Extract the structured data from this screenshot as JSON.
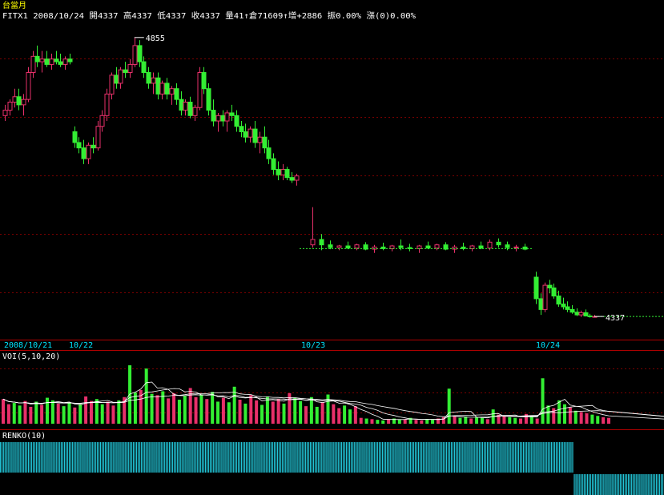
{
  "header": {
    "instrument": "台當月",
    "quote_line": "FITX1 2008/10/24 開4337 高4337 低4337 收4337 量41↑倉71609↑增+2886 振0.00% 漲(0)0.00%"
  },
  "colors": {
    "up": "#e8306a",
    "down": "#33ee33",
    "text_yellow": "#ffff00",
    "text_white": "#ffffff",
    "axis_date": "#00e5ff",
    "grid": "#7a0000",
    "renko": "#22c6d8",
    "ma_line": "#ffffff"
  },
  "chart_data": [
    {
      "type": "candlestick",
      "title": "台當月",
      "symbol": "FITX1",
      "x_labels": [
        "2008/10/21",
        "10/22",
        "10/23",
        "10/24"
      ],
      "annotations": [
        {
          "label": "4855",
          "value": 4855
        },
        {
          "label": "4337",
          "value": 4337
        }
      ],
      "ohlc": [
        [
          4710,
          4730,
          4700,
          4720
        ],
        [
          4720,
          4740,
          4710,
          4735
        ],
        [
          4735,
          4760,
          4725,
          4745
        ],
        [
          4745,
          4760,
          4720,
          4730
        ],
        [
          4730,
          4750,
          4710,
          4740
        ],
        [
          4740,
          4800,
          4735,
          4790
        ],
        [
          4790,
          4830,
          4780,
          4820
        ],
        [
          4820,
          4840,
          4800,
          4810
        ],
        [
          4810,
          4830,
          4790,
          4815
        ],
        [
          4815,
          4830,
          4800,
          4805
        ],
        [
          4805,
          4825,
          4795,
          4815
        ],
        [
          4815,
          4830,
          4805,
          4810
        ],
        [
          4810,
          4825,
          4800,
          4805
        ],
        [
          4805,
          4820,
          4795,
          4815
        ],
        [
          4815,
          4825,
          4805,
          4810
        ],
        [
          4680,
          4690,
          4650,
          4660
        ],
        [
          4660,
          4670,
          4640,
          4650
        ],
        [
          4650,
          4665,
          4620,
          4630
        ],
        [
          4630,
          4660,
          4620,
          4655
        ],
        [
          4655,
          4670,
          4640,
          4650
        ],
        [
          4650,
          4700,
          4645,
          4690
        ],
        [
          4690,
          4720,
          4680,
          4710
        ],
        [
          4710,
          4760,
          4700,
          4750
        ],
        [
          4750,
          4790,
          4740,
          4785
        ],
        [
          4785,
          4800,
          4760,
          4770
        ],
        [
          4770,
          4800,
          4760,
          4795
        ],
        [
          4795,
          4810,
          4780,
          4790
        ],
        [
          4790,
          4815,
          4780,
          4805
        ],
        [
          4805,
          4855,
          4800,
          4840
        ],
        [
          4840,
          4850,
          4800,
          4810
        ],
        [
          4810,
          4820,
          4780,
          4790
        ],
        [
          4790,
          4800,
          4760,
          4770
        ],
        [
          4770,
          4790,
          4750,
          4780
        ],
        [
          4780,
          4790,
          4740,
          4750
        ],
        [
          4750,
          4775,
          4740,
          4770
        ],
        [
          4770,
          4780,
          4740,
          4750
        ],
        [
          4750,
          4765,
          4730,
          4760
        ],
        [
          4760,
          4770,
          4730,
          4740
        ],
        [
          4740,
          4755,
          4710,
          4720
        ],
        [
          4720,
          4740,
          4710,
          4735
        ],
        [
          4735,
          4745,
          4705,
          4710
        ],
        [
          4710,
          4730,
          4700,
          4725
        ],
        [
          4725,
          4800,
          4720,
          4790
        ],
        [
          4790,
          4800,
          4750,
          4760
        ],
        [
          4760,
          4770,
          4710,
          4720
        ],
        [
          4720,
          4740,
          4690,
          4700
        ],
        [
          4700,
          4715,
          4680,
          4710
        ],
        [
          4710,
          4720,
          4690,
          4700
        ],
        [
          4700,
          4720,
          4680,
          4715
        ],
        [
          4715,
          4730,
          4700,
          4710
        ],
        [
          4710,
          4720,
          4680,
          4690
        ],
        [
          4690,
          4700,
          4670,
          4680
        ],
        [
          4680,
          4695,
          4660,
          4670
        ],
        [
          4670,
          4690,
          4660,
          4685
        ],
        [
          4685,
          4700,
          4650,
          4660
        ],
        [
          4660,
          4680,
          4640,
          4670
        ],
        [
          4670,
          4690,
          4640,
          4650
        ],
        [
          4650,
          4665,
          4620,
          4630
        ],
        [
          4630,
          4640,
          4600,
          4610
        ],
        [
          4610,
          4625,
          4590,
          4600
        ],
        [
          4600,
          4620,
          4590,
          4610
        ],
        [
          4610,
          4615,
          4590,
          4595
        ],
        [
          4595,
          4605,
          4585,
          4590
        ],
        [
          4590,
          4602,
          4580,
          4598
        ],
        [
          4470,
          4540,
          4465,
          4480
        ],
        [
          4480,
          4490,
          4460,
          4470
        ],
        [
          4470,
          4478,
          4462,
          4465
        ],
        [
          4465,
          4470,
          4460,
          4468
        ],
        [
          4468,
          4476,
          4462,
          4464
        ],
        [
          4464,
          4472,
          4460,
          4470
        ],
        [
          4470,
          4475,
          4460,
          4462
        ],
        [
          4462,
          4470,
          4455,
          4466
        ],
        [
          4466,
          4474,
          4460,
          4463
        ],
        [
          4463,
          4470,
          4458,
          4468
        ],
        [
          4468,
          4480,
          4460,
          4465
        ],
        [
          4465,
          4472,
          4458,
          4463
        ],
        [
          4463,
          4470,
          4455,
          4468
        ],
        [
          4468,
          4476,
          4462,
          4464
        ],
        [
          4464,
          4472,
          4460,
          4470
        ],
        [
          4470,
          4475,
          4460,
          4462
        ],
        [
          4462,
          4470,
          4455,
          4466
        ],
        [
          4466,
          4474,
          4460,
          4463
        ],
        [
          4463,
          4470,
          4458,
          4468
        ],
        [
          4468,
          4476,
          4462,
          4464
        ],
        [
          4464,
          4480,
          4460,
          4475
        ],
        [
          4475,
          4482,
          4465,
          4470
        ],
        [
          4470,
          4476,
          4460,
          4465
        ],
        [
          4465,
          4470,
          4458,
          4466
        ],
        [
          4466,
          4472,
          4460,
          4462
        ],
        [
          4410,
          4420,
          4360,
          4370
        ],
        [
          4370,
          4380,
          4340,
          4350
        ],
        [
          4350,
          4400,
          4345,
          4395
        ],
        [
          4395,
          4405,
          4380,
          4390
        ],
        [
          4390,
          4398,
          4370,
          4375
        ],
        [
          4375,
          4385,
          4355,
          4360
        ],
        [
          4360,
          4372,
          4350,
          4355
        ],
        [
          4355,
          4365,
          4345,
          4350
        ],
        [
          4350,
          4358,
          4342,
          4345
        ],
        [
          4345,
          4352,
          4338,
          4340
        ],
        [
          4340,
          4348,
          4336,
          4344
        ],
        [
          4344,
          4350,
          4337,
          4338
        ],
        [
          4338,
          4342,
          4335,
          4337
        ],
        [
          4337,
          4340,
          4335,
          4337
        ]
      ]
    },
    {
      "type": "bar",
      "title": "VOI(5,10,20)",
      "series_names": [
        "VOI",
        "MA5",
        "MA10",
        "MA20"
      ],
      "values": [
        38,
        30,
        32,
        28,
        35,
        26,
        34,
        29,
        40,
        36,
        31,
        27,
        33,
        25,
        30,
        42,
        35,
        38,
        30,
        34,
        28,
        36,
        41,
        90,
        48,
        52,
        85,
        46,
        44,
        50,
        39,
        47,
        37,
        43,
        55,
        41,
        45,
        38,
        49,
        34,
        40,
        33,
        57,
        37,
        31,
        44,
        36,
        29,
        42,
        34,
        38,
        31,
        47,
        40,
        35,
        27,
        41,
        26,
        33,
        45,
        30,
        24,
        28,
        22,
        27,
        9,
        8,
        7,
        6,
        5,
        7,
        8,
        6,
        7,
        9,
        6,
        5,
        7,
        6,
        8,
        10,
        54,
        12,
        9,
        11,
        8,
        10,
        9,
        7,
        22,
        14,
        12,
        10,
        9,
        8,
        15,
        11,
        8,
        70,
        28,
        24,
        36,
        30,
        25,
        20,
        18,
        16,
        14,
        12,
        10,
        9
      ]
    },
    {
      "type": "bar",
      "title": "RENKO(10)",
      "values": [
        1,
        1,
        1,
        1,
        1,
        1,
        1,
        1,
        1,
        1,
        1,
        1,
        1,
        1,
        1,
        1,
        1,
        1,
        1,
        1,
        1,
        1,
        1,
        1,
        1,
        1,
        1,
        1,
        1,
        1,
        1,
        1,
        1,
        1,
        1,
        1,
        1,
        1,
        1,
        1,
        1,
        1,
        1,
        1,
        1,
        1,
        1,
        1,
        1,
        1,
        1,
        1,
        1,
        1,
        1,
        1,
        1,
        1,
        1,
        1,
        1,
        1,
        1,
        1,
        1,
        1,
        1,
        1,
        1,
        1,
        1,
        1,
        1,
        1,
        1,
        1,
        1,
        1,
        1,
        1,
        1,
        1,
        1,
        1,
        1,
        1,
        1,
        1,
        1,
        1,
        1,
        1,
        1,
        1,
        1,
        1,
        1,
        1,
        1,
        1,
        1,
        1,
        1,
        1,
        1,
        1,
        1,
        1,
        1,
        1,
        1,
        1,
        1,
        1,
        1,
        1,
        1,
        1,
        1,
        1,
        1,
        1,
        1,
        1,
        1,
        1,
        1,
        1,
        1,
        1,
        1,
        1,
        1,
        1,
        1,
        1,
        1,
        1,
        1,
        1,
        1,
        1,
        1,
        1,
        1,
        1,
        1,
        1,
        1,
        1,
        1,
        1,
        1,
        1,
        1,
        1,
        1,
        1,
        1,
        1,
        1,
        1,
        1,
        1,
        1,
        1,
        1,
        1,
        1,
        1,
        1,
        1,
        1,
        1,
        1,
        1,
        1,
        1,
        1,
        1,
        1,
        1,
        1,
        1,
        1,
        1,
        1,
        1,
        1,
        1,
        1,
        1,
        1,
        1,
        1,
        1,
        1,
        1,
        1,
        1,
        1,
        1,
        1,
        1,
        1,
        1,
        1,
        1,
        1,
        1,
        1,
        1,
        1,
        1,
        1,
        1,
        1,
        1,
        1,
        1,
        1,
        1,
        1,
        1,
        1,
        1,
        1,
        1,
        1,
        1,
        1,
        1,
        1,
        1,
        1,
        1,
        1,
        1,
        1,
        1,
        1,
        1,
        1,
        1,
        1,
        1,
        1,
        1,
        1,
        1,
        1,
        1,
        1,
        1,
        1,
        1,
        1,
        1,
        1,
        1,
        1,
        1,
        1,
        1,
        1,
        1,
        1,
        1,
        1,
        1,
        1,
        1,
        1,
        1,
        1,
        1,
        1,
        1,
        1,
        1,
        1,
        1,
        1,
        1,
        1,
        1,
        1,
        1,
        1,
        1,
        1,
        1,
        1,
        1,
        1,
        1,
        1,
        1,
        1,
        1,
        1,
        1,
        1,
        1,
        1,
        1,
        1,
        1,
        1,
        1,
        1,
        1,
        1,
        1,
        1,
        1,
        1,
        1,
        1,
        1,
        1,
        1,
        1,
        1,
        1,
        1,
        1,
        1,
        1,
        1,
        1,
        1,
        1,
        1,
        1,
        1,
        1,
        1,
        1,
        1,
        1,
        1,
        1,
        1,
        1,
        1,
        1,
        1,
        1,
        1,
        -1,
        -1,
        -1,
        -1,
        -1,
        -1,
        -1,
        -1,
        -1,
        -1,
        -1,
        -1,
        -1,
        -1,
        -1,
        -1,
        -1,
        -1,
        -1,
        -1,
        -1,
        -1,
        -1,
        -1,
        -1,
        -1,
        -1,
        -1,
        -1,
        -1,
        -1,
        -1,
        -1,
        -1,
        -1,
        -1,
        -1,
        -1,
        -1,
        -1,
        -1,
        -1,
        -1,
        -1,
        -1,
        -1,
        -1,
        -1,
        -1,
        -1,
        -1,
        -1,
        -1,
        -1,
        -1
      ]
    }
  ]
}
